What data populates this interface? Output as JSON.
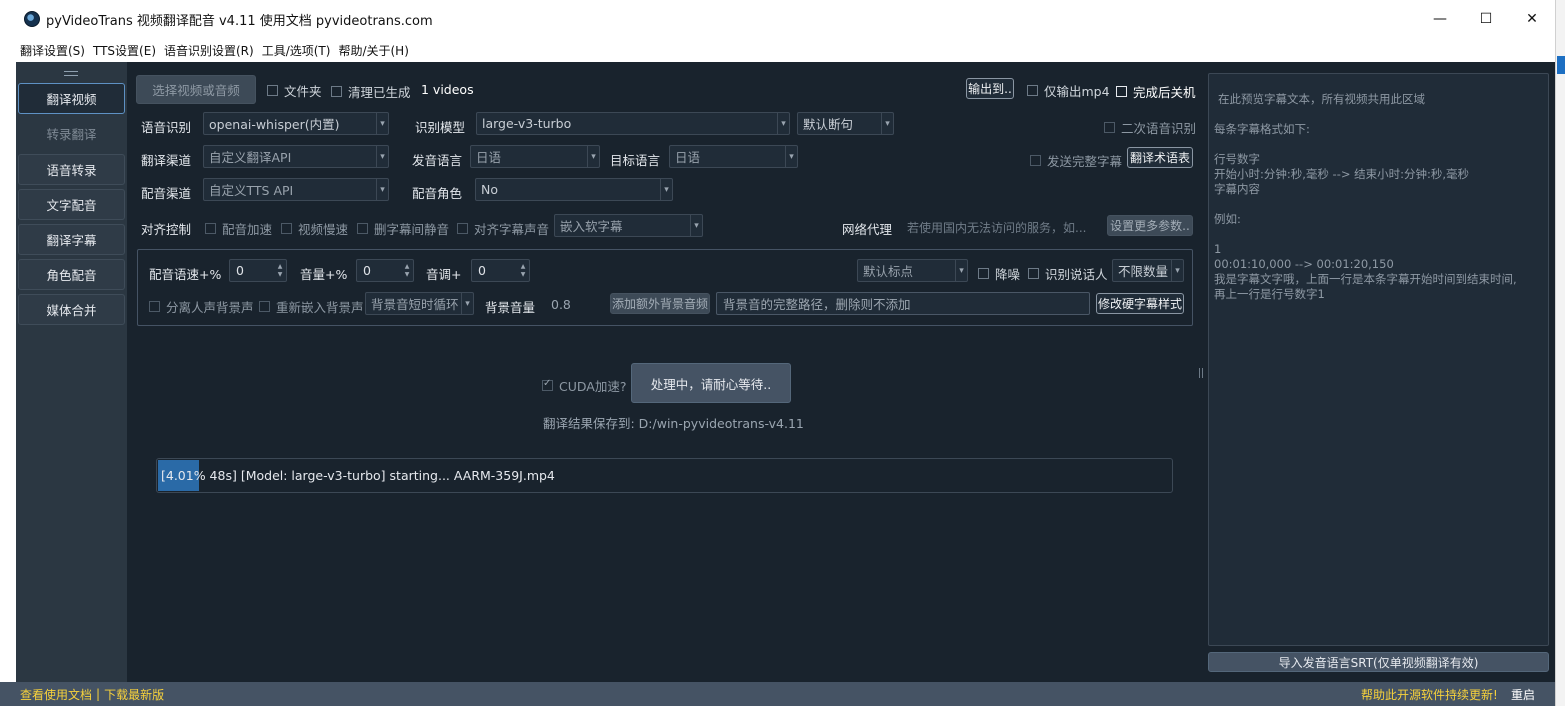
{
  "window": {
    "title": "pyVideoTrans 视频翻译配音 v4.11 使用文档 pyvideotrans.com",
    "minimize": "—",
    "maximize": "☐",
    "close": "✕"
  },
  "menu": [
    "翻译设置(S)",
    "TTS设置(E)",
    "语音识别设置(R)",
    "工具/选项(T)",
    "帮助/关于(H)"
  ],
  "sidebar": {
    "items": [
      "翻译视频",
      "转录翻译",
      "语音转录",
      "文字配音",
      "翻译字幕",
      "角色配音",
      "媒体合并"
    ]
  },
  "toolbar": {
    "select_btn": "选择视频或音频",
    "folder": "文件夹",
    "clean": "清理已生成",
    "video_count": "1 videos",
    "output_btn": "输出到..",
    "only_mp4": "仅输出mp4",
    "shutdown": "完成后关机"
  },
  "row_asr": {
    "label": "语音识别",
    "engine": "openai-whisper(内置)",
    "model_label": "识别模型",
    "model": "large-v3-turbo",
    "split": "默认断句",
    "second_asr": "二次语音识别"
  },
  "row_translate": {
    "label": "翻译渠道",
    "channel": "自定义翻译API",
    "src_label": "发音语言",
    "src": "日语",
    "tgt_label": "目标语言",
    "tgt": "日语",
    "send_full": "发送完整字幕",
    "glossary_btn": "翻译术语表"
  },
  "row_tts": {
    "label": "配音渠道",
    "channel": "自定义TTS API",
    "role_label": "配音角色",
    "role": "No"
  },
  "row_align": {
    "label": "对齐控制",
    "speedup": "配音加速",
    "slowdown": "视频慢速",
    "remove_silence": "删字幕间静音",
    "align_sub": "对齐字幕声音",
    "embed": "嵌入软字幕",
    "proxy_label": "网络代理",
    "proxy_placeholder": "若使用国内无法访问的服务，如...",
    "more_btn": "设置更多参数.."
  },
  "advanced": {
    "rate_label": "配音语速+%",
    "rate": "0",
    "volume_label": "音量+%",
    "volume": "0",
    "pitch_label": "音调+",
    "pitch": "0",
    "punct": "默认标点",
    "denoise": "降噪",
    "speaker": "识别说话人",
    "speaker_count": "不限数量",
    "separate": "分离人声背景声",
    "reembed": "重新嵌入背景声",
    "bgm_loop": "背景音短时循环",
    "bgm_vol_label": "背景音量",
    "bgm_vol": "0.8",
    "add_bgm_btn": "添加额外背景音频",
    "bgm_path_placeholder": "背景音的完整路径，删除则不添加",
    "hard_sub_btn": "修改硬字幕样式"
  },
  "run": {
    "cuda": "CUDA加速?",
    "start_btn": "处理中，请耐心等待..",
    "save_path": "翻译结果保存到: D:/win-pyvideotrans-v4.11"
  },
  "progress": {
    "percent": 4.01,
    "text": "[4.01%  48s]  [Model: large-v3-turbo] starting... AARM-359J.mp4"
  },
  "preview": {
    "placeholder": "在此预览字幕文本，所有视频共用此区域",
    "lines": [
      "每条字幕格式如下:",
      "",
      "行号数字",
      "开始小时:分钟:秒,毫秒 --> 结束小时:分钟:秒,毫秒",
      "字幕内容",
      "",
      "例如:",
      "",
      "1",
      "00:01:10,000 --> 00:01:20,150",
      "我是字幕文字哦，上面一行是本条字幕开始时间到结束时间,",
      "再上一行是行号数字1"
    ],
    "import_btn": "导入发音语言SRT(仅单视频翻译有效)"
  },
  "status": {
    "docs": "查看使用文档",
    "sep": "|",
    "download": "下载最新版",
    "help": "帮助此开源软件持续更新!",
    "restart": "重启"
  },
  "colors": {
    "bg": "#19232d",
    "panel": "#2b3742",
    "accent": "#2a6aa7",
    "link": "#f7d23b"
  }
}
